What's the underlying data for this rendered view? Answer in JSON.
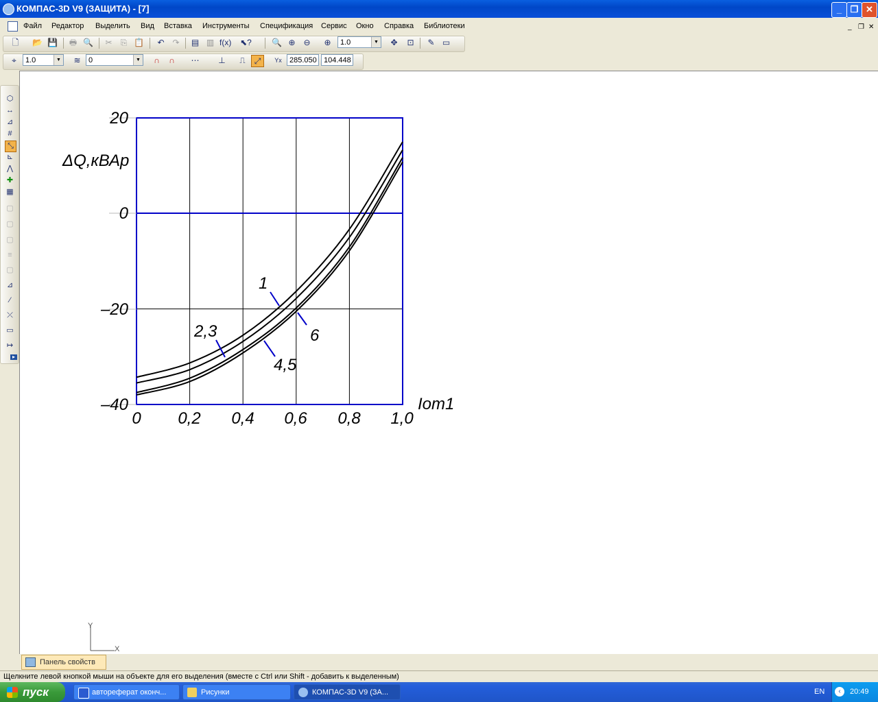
{
  "window": {
    "title": "КОМПАС-3D V9 (ЗАЩИТА) - [7]"
  },
  "menu": [
    "Файл",
    "Редактор",
    "Выделить",
    "Вид",
    "Вставка",
    "Инструменты",
    "Спецификация",
    "Сервис",
    "Окно",
    "Справка",
    "Библиотеки"
  ],
  "toolbar1": {
    "zoom_value": "1.0"
  },
  "toolbar2": {
    "step_value": "1.0",
    "layer_value": "0",
    "coord_x": "285.050",
    "coord_y": "104.448"
  },
  "drawing": {
    "ylabel": "ΔQ,кВАр",
    "xlabel": "Iom1",
    "yticks": [
      "20",
      "0",
      "–20",
      "–40"
    ],
    "xticks": [
      "0",
      "0,2",
      "0,4",
      "0,6",
      "0,8",
      "1,0"
    ],
    "curve_labels": [
      "1",
      "2,3",
      "4,5",
      "6"
    ]
  },
  "chart_data": {
    "type": "line",
    "xlabel": "Iom1",
    "ylabel": "ΔQ,кВАр",
    "xlim": [
      0,
      1.0
    ],
    "ylim": [
      -40,
      20
    ],
    "x": [
      0,
      0.2,
      0.4,
      0.6,
      0.8,
      1.0
    ],
    "series": [
      {
        "name": "1",
        "values": [
          -34.3,
          -31.3,
          -25.5,
          -16.3,
          -3.3,
          15.0
        ]
      },
      {
        "name": "2,3",
        "values": [
          -35.5,
          -32.7,
          -26.8,
          -17.8,
          -5.0,
          13.3
        ]
      },
      {
        "name": "4,5",
        "values": [
          -37.5,
          -34.5,
          -28.5,
          -19.8,
          -7.0,
          11.7
        ]
      },
      {
        "name": "6",
        "values": [
          -38.0,
          -35.2,
          -29.2,
          -20.5,
          -7.8,
          10.8
        ]
      }
    ],
    "grid": true
  },
  "origin_axes": {
    "y": "Y",
    "x": "X"
  },
  "property_panel": {
    "tab_label": "Панель свойств"
  },
  "status": {
    "text": "Щелкните левой кнопкой мыши на объекте для его выделения (вместе с Ctrl или Shift - добавить к выделенным)"
  },
  "taskbar": {
    "start_label": "пуск",
    "tasks": [
      "автореферат оконч...",
      "Рисунки",
      "КОМПАС-3D V9 (ЗА..."
    ],
    "lang": "EN",
    "clock": "20:49"
  }
}
